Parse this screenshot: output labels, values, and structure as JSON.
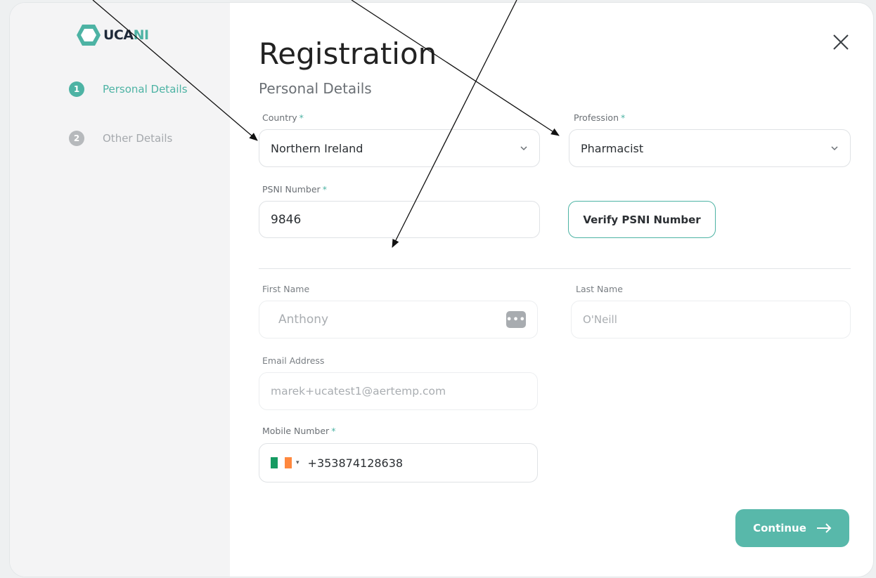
{
  "brand": {
    "logo_uca": "UCA",
    "logo_ni": "NI"
  },
  "sidebar": {
    "steps": [
      {
        "number": "1",
        "label": "Personal Details"
      },
      {
        "number": "2",
        "label": "Other Details"
      }
    ]
  },
  "header": {
    "title": "Registration",
    "subtitle": "Personal Details"
  },
  "form": {
    "country": {
      "label": "Country",
      "required": "*",
      "value": "Northern Ireland"
    },
    "profession": {
      "label": "Profession",
      "required": "*",
      "value": "Pharmacist"
    },
    "psni": {
      "label": "PSNI Number",
      "required": "*",
      "value": "9846"
    },
    "verify_label": "Verify PSNI Number",
    "first_name": {
      "label": "First Name",
      "value": "Anthony",
      "icon_text": "•••"
    },
    "last_name": {
      "label": "Last Name",
      "value": "O'Neill"
    },
    "email": {
      "label": "Email Address",
      "value": "marek+ucatest1@aertemp.com"
    },
    "mobile": {
      "label": "Mobile Number",
      "required": "*",
      "value": "+353874128638",
      "caret": "▾"
    }
  },
  "continue_label": "Continue",
  "colors": {
    "accent": "#4db3a4",
    "flag_green": "#169b62",
    "flag_white": "#ffffff",
    "flag_orange": "#ff883e"
  }
}
